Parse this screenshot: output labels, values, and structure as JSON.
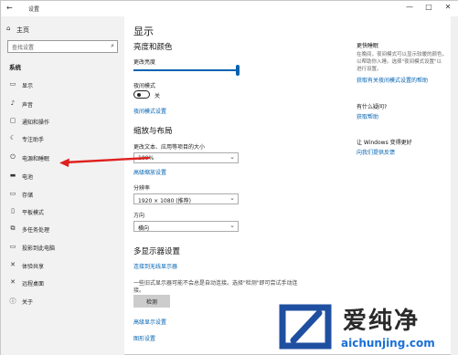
{
  "window": {
    "title": "设置",
    "back_glyph": "←",
    "minimize_glyph": "—",
    "maximize_glyph": "□",
    "close_glyph": "✕"
  },
  "sidebar": {
    "home_label": "主页",
    "search_placeholder": "查找设置",
    "section_label": "系统",
    "items": [
      {
        "label": "显示",
        "icon": "monitor-icon",
        "glyph": "▭"
      },
      {
        "label": "声音",
        "icon": "speaker-icon",
        "glyph": "♪"
      },
      {
        "label": "通知和操作",
        "icon": "notification-icon",
        "glyph": "▢"
      },
      {
        "label": "专注助手",
        "icon": "moon-icon",
        "glyph": "☾"
      },
      {
        "label": "电源和睡眠",
        "icon": "power-icon",
        "glyph": "⏻"
      },
      {
        "label": "电池",
        "icon": "battery-icon",
        "glyph": "▬"
      },
      {
        "label": "存储",
        "icon": "storage-icon",
        "glyph": "▭"
      },
      {
        "label": "平板模式",
        "icon": "tablet-icon",
        "glyph": "▯"
      },
      {
        "label": "多任务处理",
        "icon": "multitask-icon",
        "glyph": "⧉"
      },
      {
        "label": "投影到此电脑",
        "icon": "project-icon",
        "glyph": "▭"
      },
      {
        "label": "体验共享",
        "icon": "share-icon",
        "glyph": "✕"
      },
      {
        "label": "远程桌面",
        "icon": "remote-icon",
        "glyph": "✕"
      },
      {
        "label": "关于",
        "icon": "info-icon",
        "glyph": "ⓘ"
      }
    ]
  },
  "main": {
    "title": "显示",
    "brightness_header": "亮度和颜色",
    "brightness_label": "更改亮度",
    "brightness_value": 1.0,
    "night_mode_label": "夜间模式",
    "night_mode_state": "关",
    "night_mode_link": "夜间模式设置",
    "scale_header": "缩放与布局",
    "scale_label": "更改文本、应用等项目的大小",
    "scale_value": "100%",
    "advanced_scale_link": "高级缩放设置",
    "resolution_label": "分辨率",
    "resolution_value": "1920 × 1080 (推荐)",
    "orientation_label": "方向",
    "orientation_value": "横向",
    "multi_header": "多显示器设置",
    "wireless_link": "连接到无线显示器",
    "multi_desc_1": "一些旧式显示器可能不会总是自动连接。选择\"检测\"即可尝试手动连",
    "multi_desc_2": "接。",
    "detect_button": "检测",
    "advanced_display_link": "高级显示设置",
    "graphics_link": "图形设置"
  },
  "right_panel": {
    "sleep_title": "更快睡眠",
    "sleep_text_1": "在晚间，夜间模式可以显示较暖的颜色，",
    "sleep_text_2": "以帮助你入睡。选择\"夜间模式设置\"以",
    "sleep_text_3": "进行设置。",
    "sleep_link": "获取有关夜间模式设置的帮助",
    "question_title": "有什么疑问?",
    "help_link": "获取帮助",
    "improve_title": "让 Windows 变得更好",
    "feedback_link": "向我们提供反馈"
  },
  "watermark": {
    "text": "爱纯净",
    "url": "aichunjing.com"
  },
  "colors": {
    "accent": "#0063b1",
    "link": "#0062b1",
    "sidebar_bg": "#f2f2f2",
    "annotation_arrow": "#e02020"
  }
}
